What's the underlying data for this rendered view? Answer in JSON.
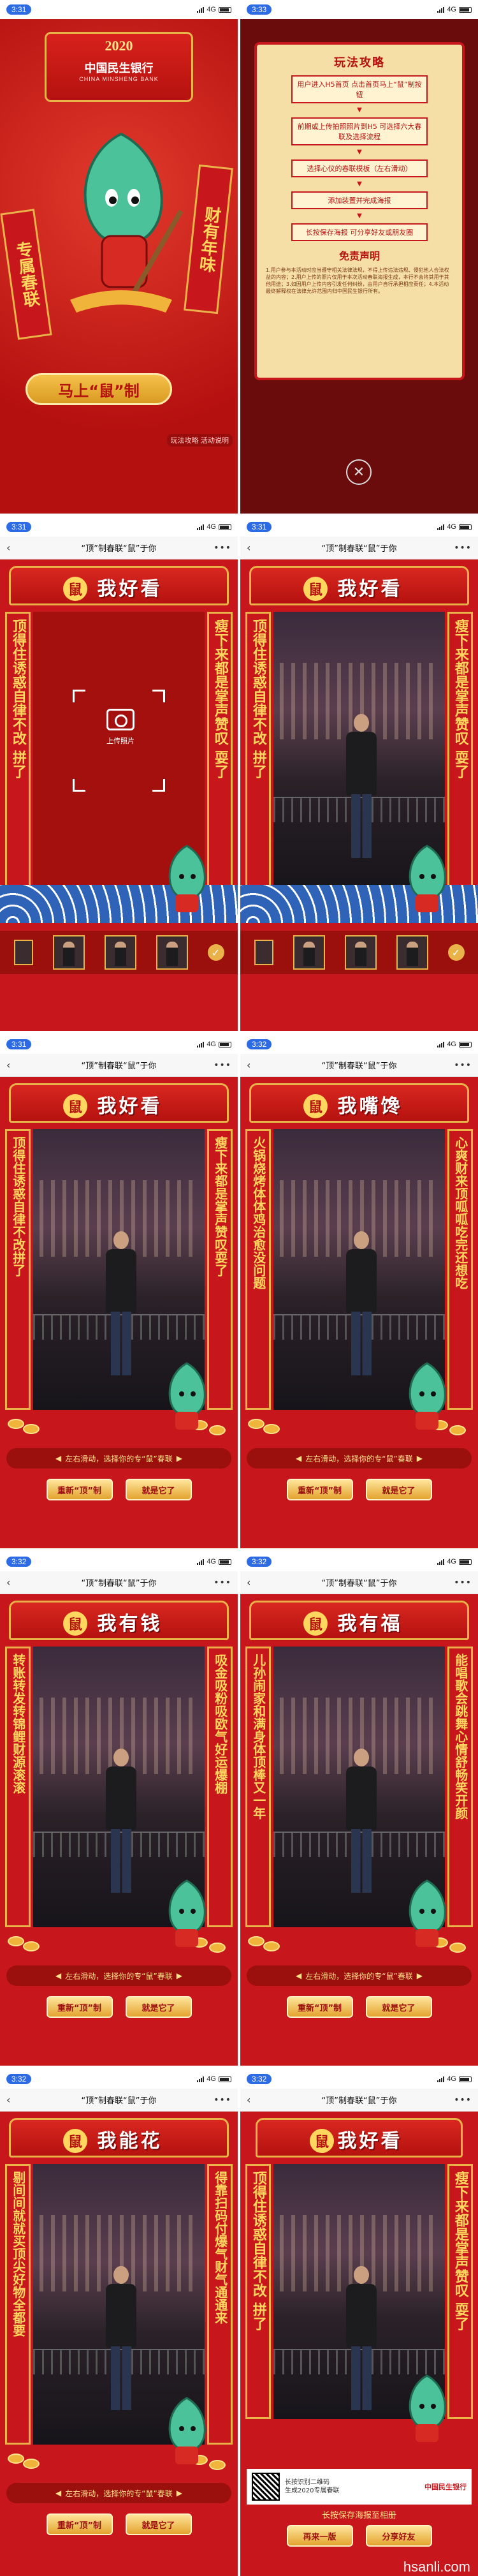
{
  "statusbar": [
    {
      "time": "3:31",
      "network": "4G"
    },
    {
      "time": "3:33",
      "network": "4G"
    },
    {
      "time": "3:31",
      "network": "4G"
    },
    {
      "time": "3:31",
      "network": "4G"
    },
    {
      "time": "3:31",
      "network": "4G"
    },
    {
      "time": "3:32",
      "network": "4G"
    },
    {
      "time": "3:32",
      "network": "4G"
    },
    {
      "time": "3:32",
      "network": "4G"
    },
    {
      "time": "3:32",
      "network": "4G"
    },
    {
      "time": "3:32",
      "network": "4G"
    }
  ],
  "nav": {
    "title": "“顶”制春联“鼠”于你",
    "back": "‹",
    "more": "•••"
  },
  "landing": {
    "year": "2020",
    "bank_name": "中国民生银行",
    "bank_en": "CHINA MINSHENG BANK",
    "left_scroll": "专属春联",
    "right_scroll": "财有年味",
    "cta": "马上“鼠”制",
    "rules_link": "玩法攻略 活动说明"
  },
  "rules": {
    "title": "玩法攻略",
    "steps": [
      "用户进入H5首页 点击首页马上“鼠”制按钮",
      "前期或上传拍照照片到H5 可选择六大春联及选择流程",
      "选择心仪的春联模板（左右滑动）",
      "添加装置并完成海报",
      "长按保存海报 可分享好友或朋友圈"
    ],
    "disclaimer_title": "免责声明",
    "disclaimer": "1.用户参与本活动时应当遵守相关法律法规，不得上传违法违规、侵犯他人合法权益的内容；2.用户上传的照片仅用于本次活动春联海报生成，本行不会将其用于其他用途；3.如因用户上传内容引发任何纠纷，由用户自行承担相应责任；4.本活动最终解释权在法律允许范围内归中国民生银行所有。"
  },
  "upload": {
    "label": "上传照片"
  },
  "poster_lines": {
    "arch_title": "我好看",
    "left": "顶得住诱惑自律不改",
    "right": "瘦下来都是掌声赞叹",
    "left_tail": "拼了",
    "right_tail": "耍了"
  },
  "couplets": [
    {
      "arch": "我好看",
      "left": "顶得住诱惑自律不改拼了",
      "right": "瘦下来都是掌声赞叹耍了"
    },
    {
      "arch": "我嘴馋",
      "left": "火锅烧烤体体鸡治愈没问题",
      "right": "心爽财来顶呱呱吃完还想吃"
    },
    {
      "arch": "我有钱",
      "left": "转账转发转锦鲤财源滚滚",
      "right": "吸金吸粉吸欧气好运爆棚"
    },
    {
      "arch": "我有福",
      "left": "儿孙闹家和满身体顶棒又一年",
      "right": "能唱歌会跳舞心情舒畅笑开颜"
    },
    {
      "arch": "我能花",
      "left": "剔间间就就买顶尖好物全都要",
      "right": "得靠扫码付爆气财气通通来"
    }
  ],
  "swipe_hint": "左右滑动，选择你的专“鼠”春联",
  "buttons": {
    "reshoot": "重新“顶”制",
    "confirm": "就是它了",
    "again": "再来一版",
    "share": "分享好友"
  },
  "poster": {
    "qr_text_1": "长按识别二维码",
    "qr_text_2": "生成2020专属春联",
    "logo": "中国民生银行",
    "save_tip": "长按保存海报至相册"
  },
  "watermark": "hsanli.com"
}
